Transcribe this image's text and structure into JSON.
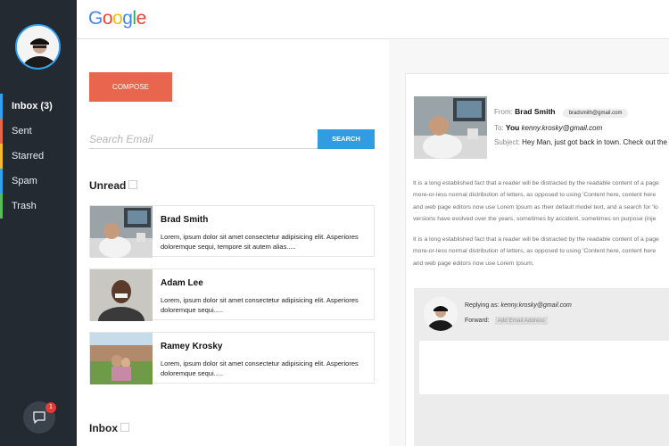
{
  "sidebar": {
    "items": [
      {
        "label": "Inbox (3)",
        "color": "#2ea3f2"
      },
      {
        "label": "Sent",
        "color": "#e8664e"
      },
      {
        "label": "Starred",
        "color": "#f5b82e"
      },
      {
        "label": "Spam",
        "color": "#2ea3f2"
      },
      {
        "label": "Trash",
        "color": "#5cb85c"
      }
    ],
    "chat_badge": "1"
  },
  "header": {
    "logo_letters": [
      "G",
      "o",
      "o",
      "g",
      "l",
      "e"
    ],
    "logo_colors": [
      "#4285f4",
      "#ea4335",
      "#fbbc05",
      "#4285f4",
      "#34a853",
      "#ea4335"
    ]
  },
  "compose_label": "COMPOSE",
  "search": {
    "placeholder": "Search Email",
    "button_label": "SEARCH"
  },
  "unread": {
    "title": "Unread",
    "emails": [
      {
        "name": "Brad Smith",
        "snippet": "Lorem, ipsum dolor sit amet consectetur adipisicing elit. Asperiores doloremque sequi, tempore sit autem alias....."
      },
      {
        "name": "Adam Lee",
        "snippet": "Lorem, ipsum dolor sit amet consectetur adipisicing elit. Asperiores doloremque sequi....."
      },
      {
        "name": "Ramey Krosky",
        "snippet": "Lorem, ipsum dolor sit amet consectetur adipisicing elit. Asperiores doloremque sequi....."
      }
    ]
  },
  "inbox": {
    "title": "Inbox"
  },
  "message": {
    "from_label": "From:",
    "from_name": "Brad Smith",
    "from_email": "bradsmith@gmail.com",
    "to_label": "To:",
    "to_name": "You",
    "to_email": "kenny.krosky@gmail.com",
    "subject_label": "Subject:",
    "subject": "Hey Man, just got back in town. Check out the",
    "paragraph1": [
      "It is a long established fact that a reader will be distracted by the readable content of a page",
      "more-or-less normal distribution of letters, as opposed to using 'Content here, content here",
      "and web page editors now use Lorem Ipsum as their default model text, and a search for 'lo",
      "versions have evolved over the years, sometimes by accident, sometimes on purpose (inje"
    ],
    "paragraph2": [
      "It is a long established fact that a reader will be distracted by the readable content of a page",
      "more-or-less normal distribution of letters, as opposed to using 'Content here, content here",
      "and web page editors now use Lorem Ipsum."
    ]
  },
  "reply": {
    "replying_label": "Replying as:",
    "replying_email": "kenny.krosky@gmail.com",
    "forward_label": "Forward:",
    "forward_placeholder": "Add Email Address"
  }
}
